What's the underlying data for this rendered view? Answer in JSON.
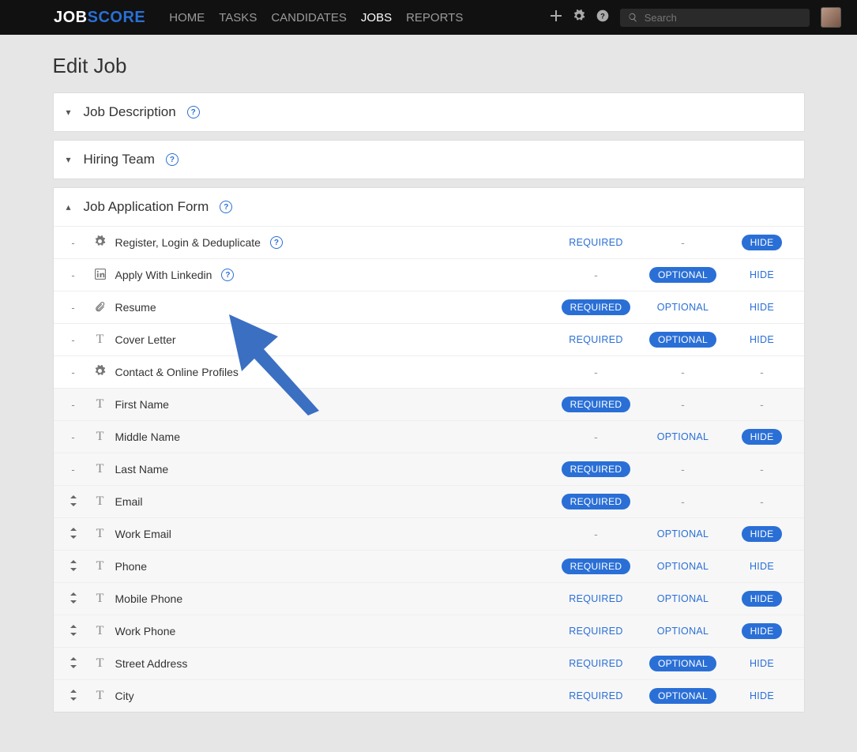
{
  "brand": {
    "part1": "JOB",
    "part2": "SCORE"
  },
  "nav": {
    "items": [
      {
        "label": "HOME",
        "active": false
      },
      {
        "label": "TASKS",
        "active": false
      },
      {
        "label": "CANDIDATES",
        "active": false
      },
      {
        "label": "JOBS",
        "active": true
      },
      {
        "label": "REPORTS",
        "active": false
      }
    ]
  },
  "search": {
    "placeholder": "Search"
  },
  "page": {
    "title": "Edit Job"
  },
  "sections": {
    "jobDescription": {
      "title": "Job Description",
      "expanded": false
    },
    "hiringTeam": {
      "title": "Hiring Team",
      "expanded": false
    },
    "appForm": {
      "title": "Job Application Form",
      "expanded": true
    }
  },
  "labels": {
    "required": "REQUIRED",
    "optional": "OPTIONAL",
    "hide": "HIDE"
  },
  "rows": [
    {
      "drag": "-",
      "icon": "gear",
      "name": "Register, Login & Deduplicate",
      "help": true,
      "required": "link",
      "optional": "dash",
      "hide": "pill",
      "sub": false
    },
    {
      "drag": "-",
      "icon": "linkedin",
      "name": "Apply With Linkedin",
      "help": true,
      "required": "dash",
      "optional": "pill",
      "hide": "link",
      "sub": false
    },
    {
      "drag": "-",
      "icon": "clip",
      "name": "Resume",
      "help": false,
      "required": "pill",
      "optional": "link",
      "hide": "link",
      "sub": false
    },
    {
      "drag": "-",
      "icon": "T",
      "name": "Cover Letter",
      "help": false,
      "required": "link",
      "optional": "pill",
      "hide": "link",
      "sub": false
    },
    {
      "drag": "-",
      "icon": "gear",
      "name": "Contact & Online Profiles",
      "help": false,
      "required": "dash",
      "optional": "dash",
      "hide": "dash",
      "sub": false
    },
    {
      "drag": "-",
      "icon": "T",
      "name": "First Name",
      "help": false,
      "required": "pill",
      "optional": "dash",
      "hide": "dash",
      "sub": true
    },
    {
      "drag": "-",
      "icon": "T",
      "name": "Middle Name",
      "help": false,
      "required": "dash",
      "optional": "link",
      "hide": "pill",
      "sub": true
    },
    {
      "drag": "-",
      "icon": "T",
      "name": "Last Name",
      "help": false,
      "required": "pill",
      "optional": "dash",
      "hide": "dash",
      "sub": true
    },
    {
      "drag": "sort",
      "icon": "T",
      "name": "Email",
      "help": false,
      "required": "pill",
      "optional": "dash",
      "hide": "dash",
      "sub": true
    },
    {
      "drag": "sort",
      "icon": "T",
      "name": "Work Email",
      "help": false,
      "required": "dash",
      "optional": "link",
      "hide": "pill",
      "sub": true
    },
    {
      "drag": "sort",
      "icon": "T",
      "name": "Phone",
      "help": false,
      "required": "pill",
      "optional": "link",
      "hide": "link",
      "sub": true
    },
    {
      "drag": "sort",
      "icon": "T",
      "name": "Mobile Phone",
      "help": false,
      "required": "link",
      "optional": "link",
      "hide": "pill",
      "sub": true
    },
    {
      "drag": "sort",
      "icon": "T",
      "name": "Work Phone",
      "help": false,
      "required": "link",
      "optional": "link",
      "hide": "pill",
      "sub": true
    },
    {
      "drag": "sort",
      "icon": "T",
      "name": "Street Address",
      "help": false,
      "required": "link",
      "optional": "pill",
      "hide": "link",
      "sub": true
    },
    {
      "drag": "sort",
      "icon": "T",
      "name": "City",
      "help": false,
      "required": "link",
      "optional": "pill",
      "hide": "link",
      "sub": true
    }
  ]
}
